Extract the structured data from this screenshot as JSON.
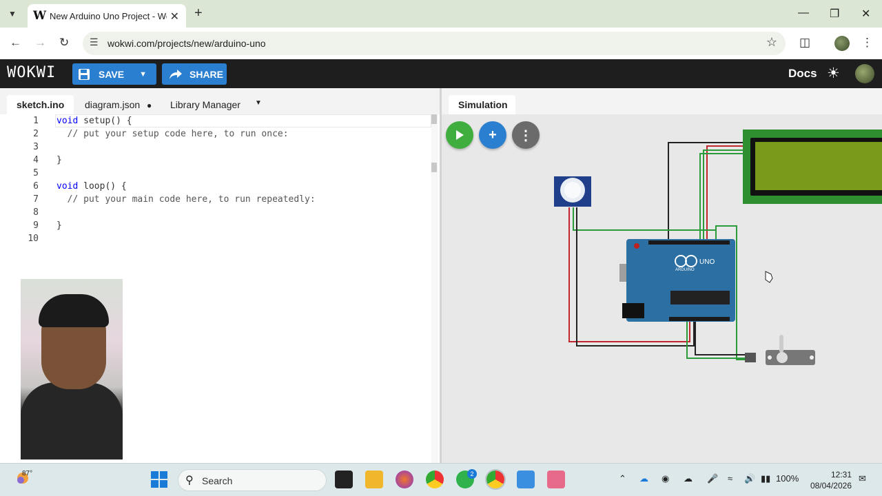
{
  "browser": {
    "tab_title": "New Arduino Uno Project - Wokwi",
    "new_tab_icon": "plus-icon",
    "url": "wokwi.com/projects/new/arduino-uno"
  },
  "wokwi": {
    "logo": "WOKWI",
    "save_label": "SAVE",
    "share_label": "SHARE",
    "docs_label": "Docs"
  },
  "editor": {
    "tabs": [
      "sketch.ino",
      "diagram.json",
      "Library Manager"
    ],
    "active_tab": "sketch.ino",
    "modified_marker": "●",
    "lines": [
      {
        "n": "1",
        "kw": "void",
        "rest": " setup() {"
      },
      {
        "n": "2",
        "kw": "",
        "rest": "  // put your setup code here, to run once:"
      },
      {
        "n": "3",
        "kw": "",
        "rest": ""
      },
      {
        "n": "4",
        "kw": "",
        "rest": "}"
      },
      {
        "n": "5",
        "kw": "",
        "rest": ""
      },
      {
        "n": "6",
        "kw": "void",
        "rest": " loop() {"
      },
      {
        "n": "7",
        "kw": "",
        "rest": "  // put your main code here, to run repeatedly:"
      },
      {
        "n": "8",
        "kw": "",
        "rest": ""
      },
      {
        "n": "9",
        "kw": "",
        "rest": "}"
      },
      {
        "n": "10",
        "kw": "",
        "rest": ""
      }
    ]
  },
  "simulation": {
    "tab_label": "Simulation",
    "board_label": "UNO",
    "board_brand": "ARDUINO",
    "colors": {
      "play": "#3fae3f",
      "add": "#2a7fd0",
      "more": "#6b6b6b",
      "board": "#2b6fa3",
      "lcd": "#7a9a1a"
    }
  },
  "taskbar": {
    "temperature": "87°",
    "search_label": "Search",
    "whatsapp_badge": "2",
    "battery": "100%",
    "time": "12:31",
    "date": "08/04/2026"
  }
}
